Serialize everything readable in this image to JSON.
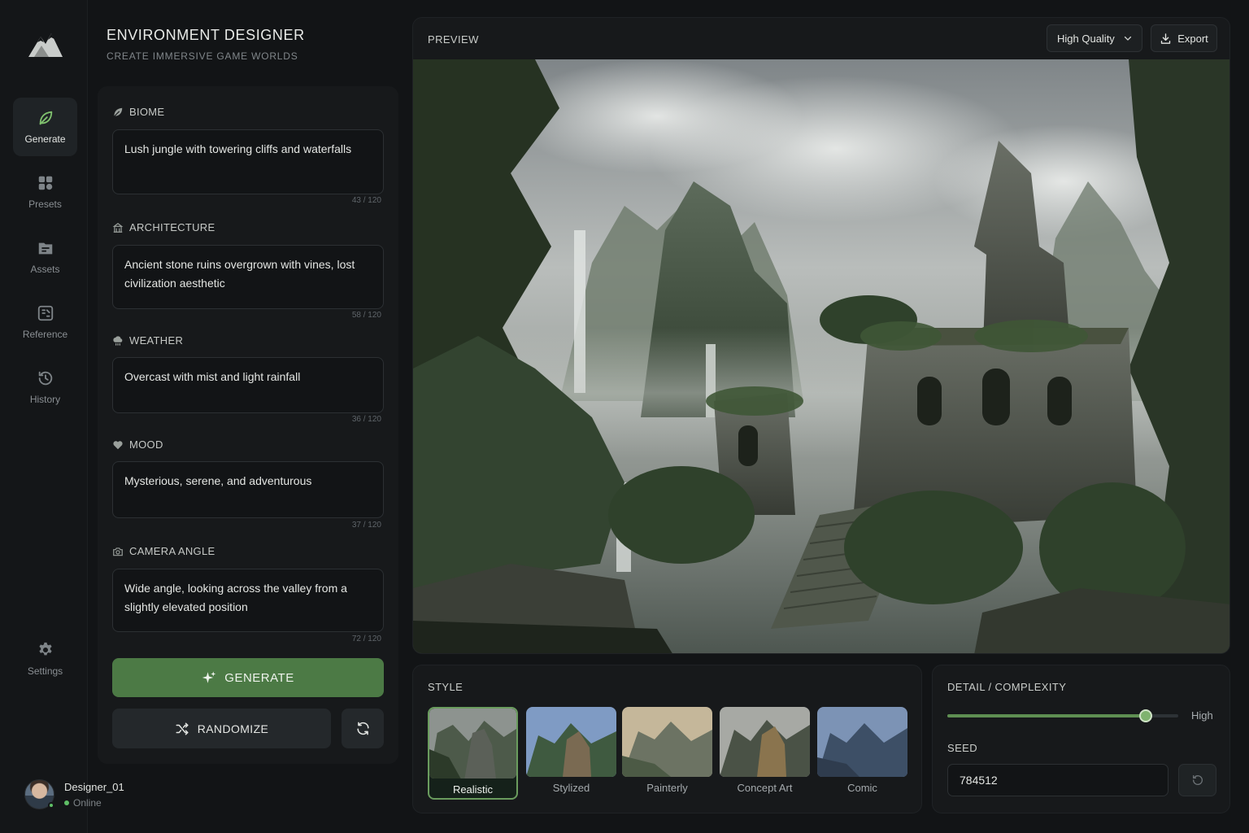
{
  "app": {
    "title": "ENVIRONMENT DESIGNER",
    "subtitle": "CREATE IMMERSIVE GAME WORLDS",
    "accent_color": "#4c7a45"
  },
  "sidebar": {
    "items": [
      {
        "label": "Generate",
        "icon": "leaf-icon",
        "active": true
      },
      {
        "label": "Presets",
        "icon": "presets-icon",
        "active": false
      },
      {
        "label": "Assets",
        "icon": "folder-icon",
        "active": false
      },
      {
        "label": "Reference",
        "icon": "reference-icon",
        "active": false
      },
      {
        "label": "History",
        "icon": "history-icon",
        "active": false
      }
    ],
    "settings_label": "Settings"
  },
  "user": {
    "name": "Designer_01",
    "status": "Online"
  },
  "form": {
    "fields": [
      {
        "label": "BIOME",
        "icon": "leaf-icon",
        "value": "Lush jungle with towering cliffs and waterfalls",
        "counter": "43 / 120"
      },
      {
        "label": "ARCHITECTURE",
        "icon": "building-icon",
        "value": "Ancient stone ruins overgrown with vines, lost civilization aesthetic",
        "counter": "58 / 120"
      },
      {
        "label": "WEATHER",
        "icon": "cloud-rain-icon",
        "value": "Overcast with mist and light rainfall",
        "counter": "36 / 120"
      },
      {
        "label": "MOOD",
        "icon": "heart-icon",
        "value": "Mysterious, serene, and adventurous",
        "counter": "37 / 120"
      },
      {
        "label": "CAMERA ANGLE",
        "icon": "camera-icon",
        "value": "Wide angle, looking across the valley from a slightly elevated position",
        "counter": "72 / 120"
      }
    ],
    "generate_label": "GENERATE",
    "randomize_label": "RANDOMIZE"
  },
  "preview": {
    "title": "PREVIEW",
    "quality": "High Quality",
    "export_label": "Export"
  },
  "style": {
    "title": "STYLE",
    "options": [
      {
        "label": "Realistic",
        "selected": true
      },
      {
        "label": "Stylized",
        "selected": false
      },
      {
        "label": "Painterly",
        "selected": false
      },
      {
        "label": "Concept Art",
        "selected": false
      },
      {
        "label": "Comic",
        "selected": false
      }
    ]
  },
  "detail": {
    "title": "DETAIL / COMPLEXITY",
    "level": 0.86,
    "level_label": "High",
    "seed_label": "SEED",
    "seed_value": "784512"
  }
}
